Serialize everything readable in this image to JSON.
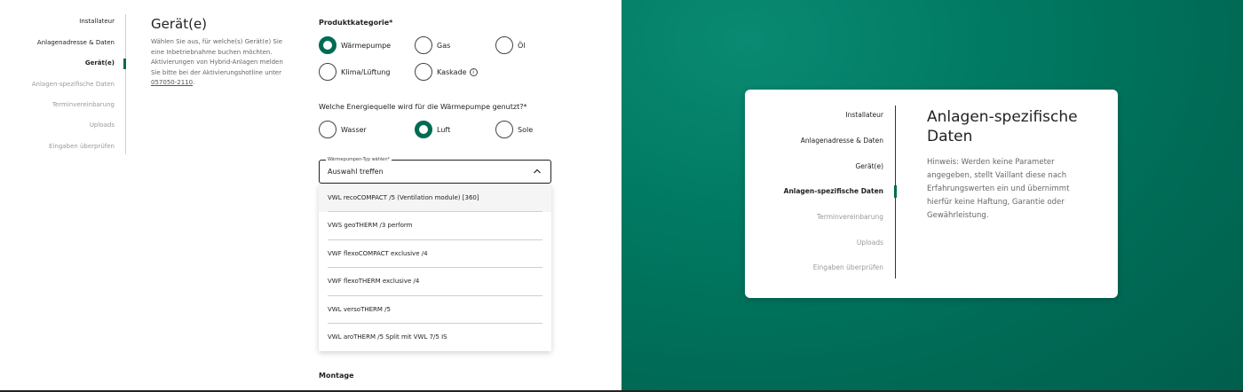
{
  "left_panel": {
    "steps": [
      {
        "label": "Installateur",
        "state": "done"
      },
      {
        "label": "Anlagenadresse & Daten",
        "state": "done"
      },
      {
        "label": "Gerät(e)",
        "state": "active"
      },
      {
        "label": "Anlagen-spezifische Daten",
        "state": "inactive"
      },
      {
        "label": "Terminvereinbarung",
        "state": "inactive"
      },
      {
        "label": "Uploads",
        "state": "inactive"
      },
      {
        "label": "Eingaben überprüfen",
        "state": "inactive"
      }
    ],
    "title": "Gerät(e)",
    "description": "Wählen Sie aus, für welche(s) Gerät(e) Sie eine Inbetriebnahme buchen möchten. Aktivierungen von Hybrid-Anlagen melden Sie bitte bei der Aktivierungshotline unter ",
    "hotline": "057050-2110",
    "description_end": ".",
    "category_label": "Produktkategorie*",
    "categories": [
      {
        "label": "Wärmepumpe",
        "checked": true
      },
      {
        "label": "Gas",
        "checked": false
      },
      {
        "label": "Öl",
        "checked": false
      },
      {
        "label": "Klima/Lüftung",
        "checked": false
      },
      {
        "label": "Kaskade",
        "checked": false
      }
    ],
    "energy_label": "Welche Energiequelle wird für die Wärmepumpe genutzt?*",
    "energy_sources": [
      {
        "label": "Wasser",
        "checked": false
      },
      {
        "label": "Luft",
        "checked": true
      },
      {
        "label": "Sole",
        "checked": false
      }
    ],
    "select": {
      "float_label": "Wärmepumpen-Typ wählen*",
      "value": "Auswahl treffen"
    },
    "options": [
      "VWL recoCOMPACT /5 (Ventilation module) [360]",
      "VWS geoTHERM /3 perform",
      "VWF flexoCOMPACT exclusive /4",
      "VWF flexoTHERM exclusive /4",
      "VWL versoTHERM /5",
      "VWL aroTHERM /5 Split mit VWL 7/5 IS"
    ],
    "montage_label": "Montage"
  },
  "right_panel": {
    "steps": [
      {
        "label": "Installateur",
        "state": "done"
      },
      {
        "label": "Anlagenadresse & Daten",
        "state": "done"
      },
      {
        "label": "Gerät(e)",
        "state": "done"
      },
      {
        "label": "Anlagen-spezifische Daten",
        "state": "active"
      },
      {
        "label": "Terminvereinbarung",
        "state": "inactive"
      },
      {
        "label": "Uploads",
        "state": "inactive"
      },
      {
        "label": "Eingaben überprüfen",
        "state": "inactive"
      }
    ],
    "title": "Anlagen-spezifische Daten",
    "text": "Hinweis: Werden keine Parameter angegeben, stellt Vaillant diese nach Erfahrungswerten ein und übernimmt hierfür keine Haftung, Garantie oder Gewährleistung."
  },
  "colors": {
    "accent": "#006b53",
    "background_right": "#017a63"
  }
}
